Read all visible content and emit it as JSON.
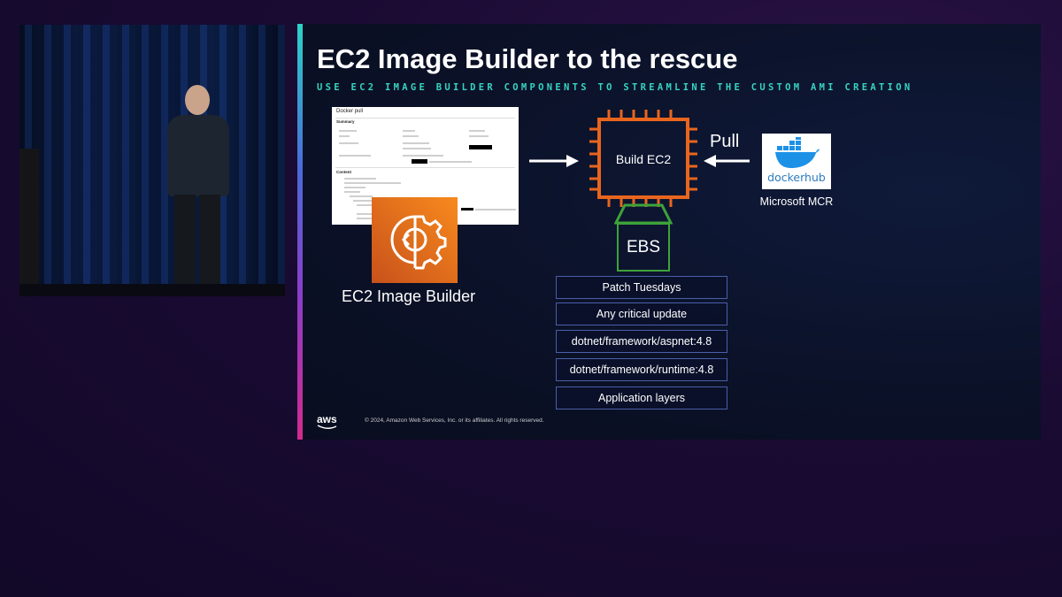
{
  "slide": {
    "title": "EC2 Image Builder to the rescue",
    "subtitle": "USE EC2 IMAGE BUILDER COMPONENTS TO STREAMLINE THE CUSTOM AMI CREATION",
    "doc_title": "Docker pull",
    "doc_summary": "Summary",
    "doc_content": "Content",
    "image_builder_label": "EC2 Image Builder",
    "chip_label": "Build EC2",
    "pull_label": "Pull",
    "ebs_label": "EBS",
    "docker_hub_text": "dockerhub",
    "mcr_label": "Microsoft MCR",
    "layers": [
      "Patch Tuesdays",
      "Any critical update",
      "dotnet/framework/aspnet:4.8",
      "dotnet/framework/runtime:4.8",
      "Application layers"
    ],
    "aws_logo_text": "aws",
    "copyright": "© 2024, Amazon Web Services, Inc. or its affiliates. All rights reserved."
  },
  "colors": {
    "accent_teal": "#37d3c1",
    "chip_orange": "#e8651e",
    "ebs_green": "#3ea33a",
    "image_builder_orange": "#f78a1d"
  }
}
